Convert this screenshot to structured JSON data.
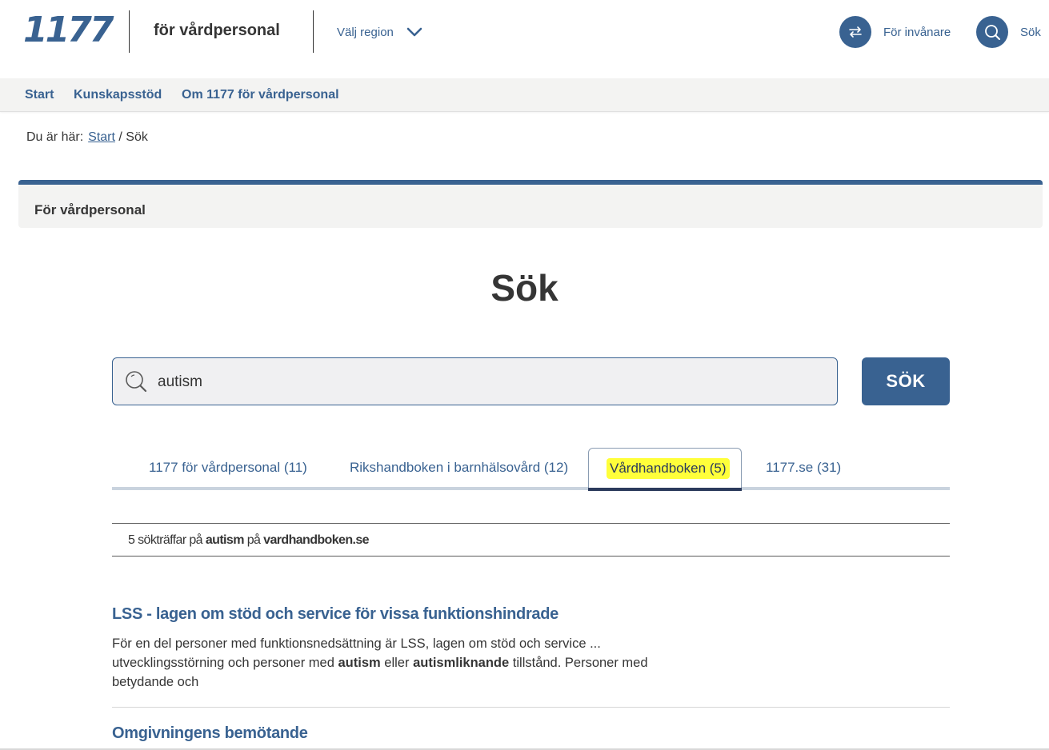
{
  "header": {
    "logo": "1177",
    "subtitle": "för vårdpersonal",
    "region_label": "Välj region",
    "invanare_label": "För invånare",
    "search_label": "Sök"
  },
  "nav": {
    "items": [
      {
        "label": "Start"
      },
      {
        "label": "Kunskapsstöd"
      },
      {
        "label": "Om 1177 för vårdpersonal"
      }
    ]
  },
  "breadcrumb": {
    "prefix": "Du är här:",
    "link": "Start",
    "separator": "/",
    "current": "Sök"
  },
  "banner": {
    "title": "För vårdpersonal"
  },
  "page": {
    "title": "Sök"
  },
  "search": {
    "value": "autism",
    "button_label": "SÖK"
  },
  "tabs": [
    {
      "label": "1177 för vårdpersonal (11)",
      "active": false
    },
    {
      "label": "Rikshandboken i barnhälsovård (12)",
      "active": false
    },
    {
      "label": "Vårdhandboken (5)",
      "active": true
    },
    {
      "label": "1177.se (31)",
      "active": false
    }
  ],
  "results_info": {
    "count_text": "5 sökträffar på",
    "query": "autism",
    "on_text": "på",
    "site": "vardhandboken.se"
  },
  "results": [
    {
      "title": "LSS - lagen om stöd och service för vissa funktionshindrade",
      "snippet_1": "För en del personer med funktionsnedsättning är LSS, lagen om stöd och service ...",
      "snippet_2a": "utvecklingsstörning och personer med",
      "snippet_2b": "autism",
      "snippet_2c": "eller",
      "snippet_2d": "autismliknande",
      "snippet_2e": "tillstånd. Personer med",
      "snippet_3": "betydande och"
    },
    {
      "title": "Omgivningens bemötande"
    }
  ],
  "colors": {
    "brand_blue": "#396291",
    "highlight_yellow": "#ffff3a",
    "text_dark": "#353535",
    "panel_grey": "#f3f3f2"
  }
}
